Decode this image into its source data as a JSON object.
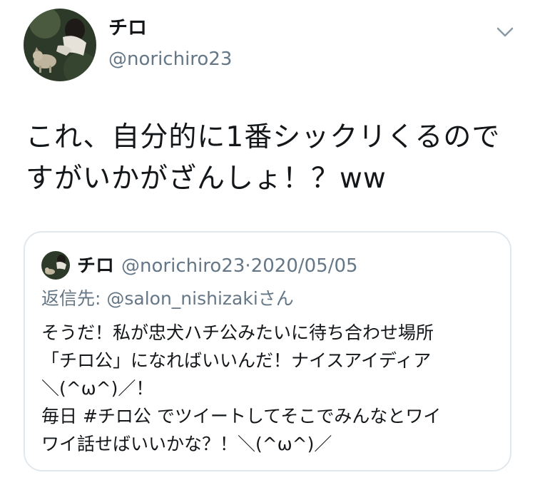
{
  "author": {
    "name": "チロ",
    "handle": "@norichiro23",
    "avatar_icon": "profile-photo-dog"
  },
  "tweet": {
    "lines": [
      "これ、自分的に1番シックリくるので",
      "すがいかがざんしょ！？ww"
    ]
  },
  "menu": {
    "icon": "chevron-down-icon"
  },
  "quoted_tweet": {
    "name": "チロ",
    "handle": "@norichiro23",
    "separator": "·",
    "date": "2020/05/05",
    "reply_prefix": "返信先: ",
    "reply_user": "@salon_nishizaki",
    "reply_suffix": "さん",
    "lines": [
      "そうだ！私が忠犬ハチ公みたいに待ち合わせ場所",
      "「チロ公」になればいいんだ！ナイスアイディア",
      "＼(^ω^)／！",
      "毎日 #チロ公 でツイートしてそこでみんなとワイ",
      "ワイ話せばいいかな？！＼(^ω^)／"
    ]
  },
  "colors": {
    "text_primary": "#14171a",
    "text_secondary": "#657786",
    "border": "#e1e8ed"
  }
}
